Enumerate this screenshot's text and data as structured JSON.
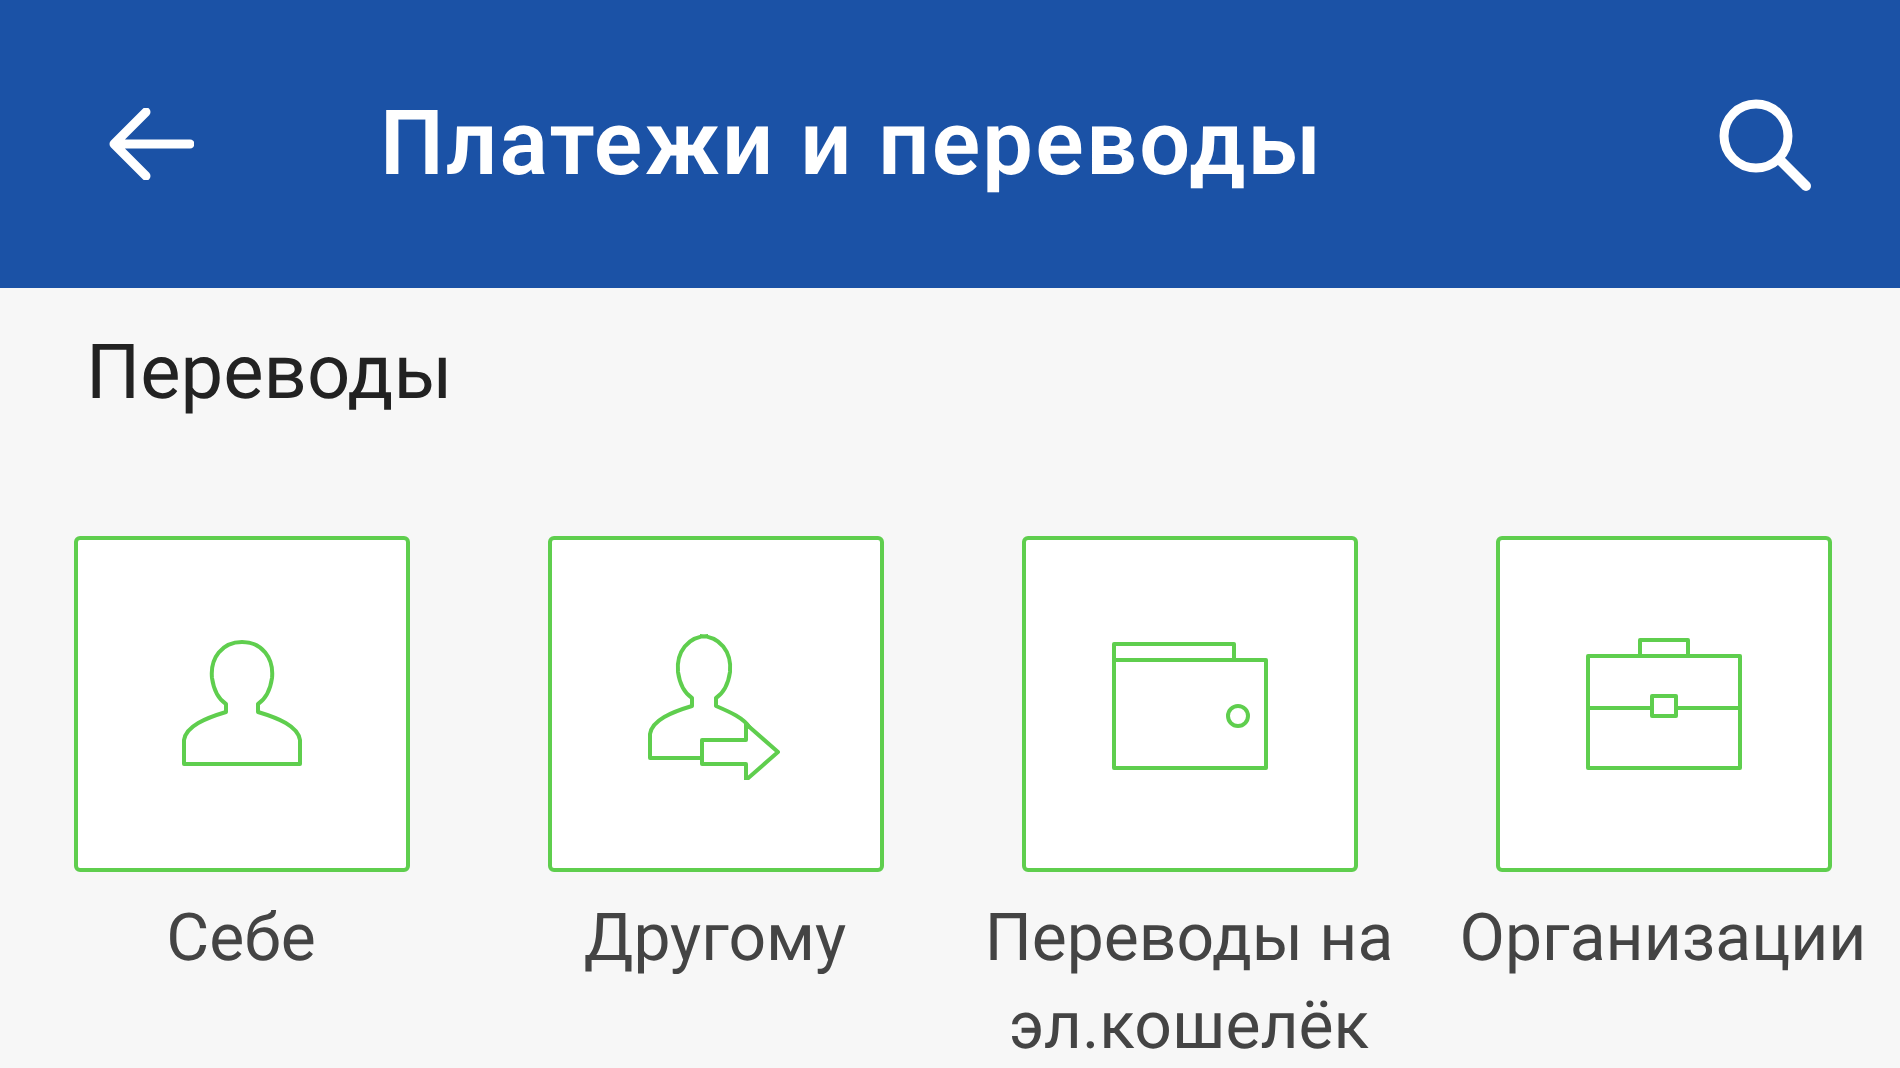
{
  "header": {
    "title": "Платежи и переводы"
  },
  "section": {
    "title": "Переводы"
  },
  "tiles": [
    {
      "kind": "self",
      "label": "Себе"
    },
    {
      "kind": "other",
      "label": "Другому"
    },
    {
      "kind": "wallet",
      "label": "Переводы на эл.кошелёк"
    },
    {
      "kind": "organization",
      "label": "Организации"
    }
  ]
}
